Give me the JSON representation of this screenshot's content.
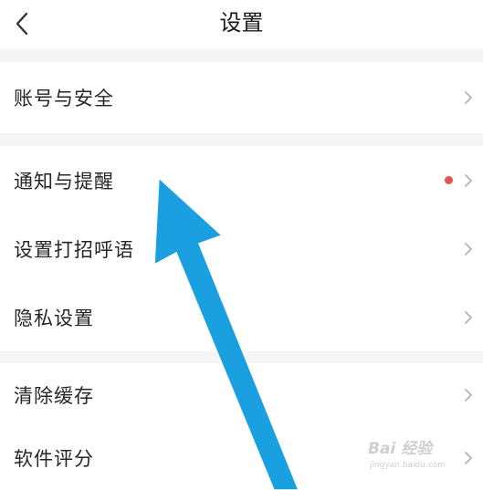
{
  "header": {
    "title": "设置",
    "back_icon": "chevron-left-icon"
  },
  "groups": [
    {
      "items": [
        {
          "label": "账号与安全"
        }
      ]
    },
    {
      "items": [
        {
          "label": "通知与提醒",
          "has_badge": true
        },
        {
          "label": "设置打招呼语"
        },
        {
          "label": "隐私设置"
        }
      ]
    },
    {
      "items": [
        {
          "label": "清除缓存"
        },
        {
          "label": "软件评分"
        }
      ]
    }
  ],
  "colors": {
    "background": "#f5f5f5",
    "card": "#ffffff",
    "badge": "#e65353",
    "chevron": "#b3b3b3",
    "annotation_arrow": "#1a9fe0"
  },
  "annotation": {
    "type": "arrow",
    "icon": "arrow-up-left-annotation",
    "color": "#1a9fe0"
  },
  "watermark": {
    "main": "Bai 经验",
    "sub": "jingyan.baidu.com"
  }
}
